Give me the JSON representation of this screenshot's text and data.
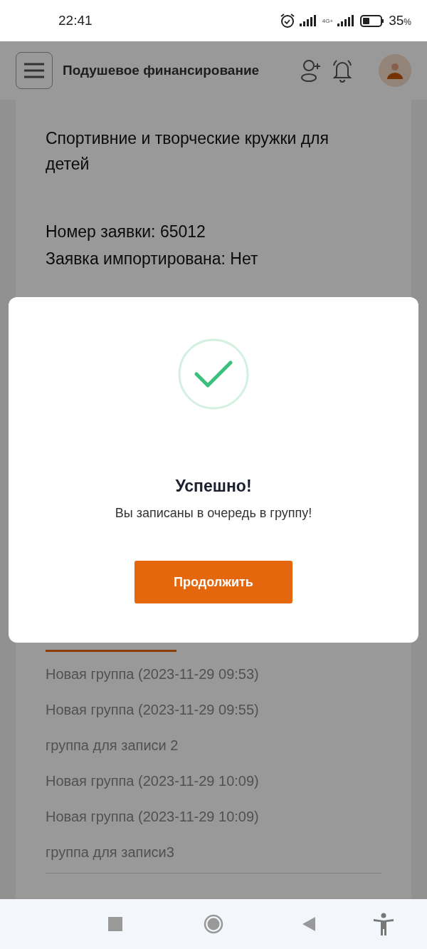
{
  "status_bar": {
    "time": "22:41",
    "network": "4G+",
    "battery": "35",
    "battery_unit": "%"
  },
  "header": {
    "title": "Подушевое финансирование"
  },
  "card": {
    "title": "Спортивние и творческие кружки для детей",
    "fields": [
      "Номер заявки: 65012",
      "Заявка импортирована: Нет"
    ],
    "groups": [
      "Новая группа (2023-11-29 09:53)",
      "Новая группа (2023-11-29 09:55)",
      "группа для записи 2",
      "Новая группа (2023-11-29 10:09)",
      "Новая группа (2023-11-29 10:09)",
      "группа для записи3"
    ]
  },
  "dialog": {
    "title": "Успешно!",
    "message": "Вы записаны в очередь в группу!",
    "button": "Продолжить"
  }
}
